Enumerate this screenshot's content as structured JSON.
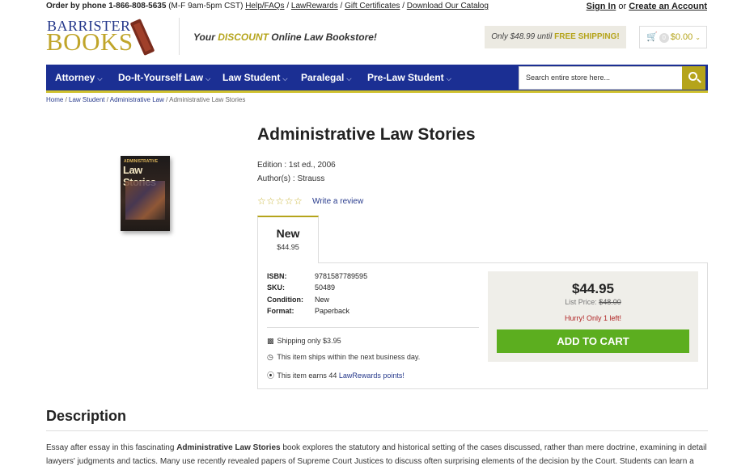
{
  "topbar": {
    "order_label": "Order by phone",
    "phone": "1-866-808-5635",
    "hours": "(M-F 9am-5pm CST)",
    "links": [
      "Help/FAQs",
      "LawRewards",
      "Gift Certificates",
      "Download Our Catalog"
    ],
    "separator": " / ",
    "sign_in": "Sign In",
    "or": "or",
    "create_account": "Create an Account"
  },
  "logo": {
    "line1": "BARRISTER",
    "line2": "BOOKS"
  },
  "tagline": {
    "prefix": "Your",
    "highlight": "DISCOUNT",
    "suffix": "Online Law Bookstore!"
  },
  "shipping_banner": {
    "text": "Only $48.99 until",
    "highlight": "FREE SHIPPING!"
  },
  "cart": {
    "count": "0",
    "amount": "$0.00"
  },
  "nav": {
    "items": [
      "Attorney",
      "Do-It-Yourself Law",
      "Law Student",
      "Paralegal",
      "Pre-Law Student"
    ],
    "search_placeholder": "Search entire store here..."
  },
  "breadcrumb": [
    "Home",
    "Law Student",
    "Administrative Law",
    "Administrative Law Stories"
  ],
  "product": {
    "cover_line1": "ADMINISTRATIVE",
    "cover_line2": "Law Stories",
    "title": "Administrative Law Stories",
    "edition": "Edition : 1st ed., 2006",
    "authors": "Author(s) : Strauss",
    "stars": "☆☆☆☆☆",
    "write_review": "Write a review",
    "tab": {
      "name": "New",
      "price": "$44.95"
    },
    "specs": [
      {
        "label": "ISBN:",
        "value": "9781587789595"
      },
      {
        "label": "SKU:",
        "value": "50489"
      },
      {
        "label": "Condition:",
        "value": "New"
      },
      {
        "label": "Format:",
        "value": "Paperback"
      }
    ],
    "shipping": "Shipping only $3.95",
    "ships_within": "This item ships within the next business day.",
    "earns_prefix": "This item earns 44",
    "earns_link": "LawRewards points!",
    "price": "$44.95",
    "list_price_label": "List Price:",
    "list_price": "$48.00",
    "hurry": "Hurry! Only 1 left!",
    "add_to_cart": "ADD TO CART"
  },
  "description": {
    "heading": "Description",
    "text_prefix": "Essay after essay in this fascinating",
    "text_bold": "Administrative Law Stories",
    "text_suffix": "book explores the statutory and historical setting of the cases discussed, rather than mere doctrine, examining in detail lawyers' judgments and tactics. Many use recently revealed papers of Supreme Court Justices to discuss often surprising elements of the decision by the Court. Students can learn a"
  }
}
